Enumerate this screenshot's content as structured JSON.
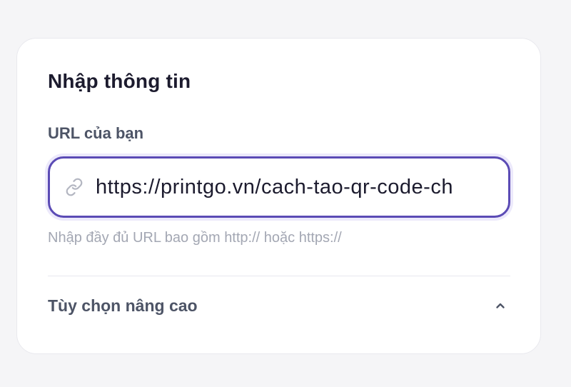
{
  "card": {
    "title": "Nhập thông tin",
    "url_field": {
      "label": "URL của bạn",
      "value": "https://printgo.vn/cach-tao-qr-code-ch",
      "icon": "link-icon",
      "hint": "Nhập đầy đủ URL bao gồm http:// hoặc https://"
    },
    "advanced_options": {
      "label": "Tùy chọn nâng cao",
      "icon": "chevron-up-icon",
      "expanded": true
    }
  },
  "colors": {
    "accent": "#5b4bb5",
    "title": "#1c1b2e",
    "label": "#4d5466",
    "hint": "#a3a7b3"
  }
}
